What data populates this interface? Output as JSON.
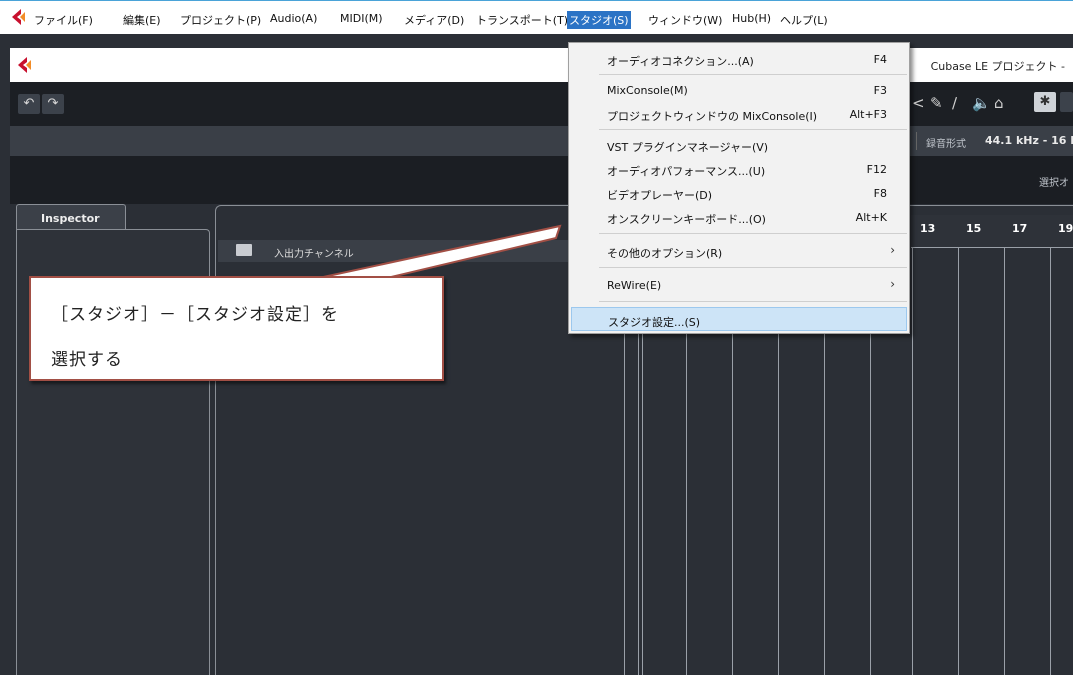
{
  "colors": {
    "accent": "#2b73c5",
    "callout_border": "#a24f45",
    "menu_highlight": "#cde4f7",
    "dark_bg": "#2b2f36"
  },
  "menubar": {
    "items": [
      "ファイル(F)",
      "編集(E)",
      "プロジェクト(P)",
      "Audio(A)",
      "MIDI(M)",
      "メディア(D)",
      "トランスポート(T)",
      "スタジオ(S)",
      "ウィンドウ(W)",
      "Hub(H)",
      "ヘルプ(L)"
    ],
    "active": "スタジオ(S)"
  },
  "window": {
    "title": "Cubase LE プロジェクト -"
  },
  "infobar": {
    "record_format_label": "録音形式",
    "record_format_value": "44.1 kHz - 16 B"
  },
  "band": {
    "select_label": "選択オ"
  },
  "inspector": {
    "tab_label": "Inspector"
  },
  "track": {
    "name": "入出力チャンネル"
  },
  "ruler": {
    "numbers": [
      "13",
      "15",
      "17",
      "19"
    ]
  },
  "dropdown": {
    "items": [
      {
        "label": "オーディオコネクション...(A)",
        "shortcut": "F4"
      },
      {
        "label": "MixConsole(M)",
        "shortcut": "F3"
      },
      {
        "label": "プロジェクトウィンドウの MixConsole(I)",
        "shortcut": "Alt+F3"
      },
      {
        "label": "VST プラグインマネージャー(V)",
        "shortcut": ""
      },
      {
        "label": "オーディオパフォーマンス...(U)",
        "shortcut": "F12"
      },
      {
        "label": "ビデオプレーヤー(D)",
        "shortcut": "F8"
      },
      {
        "label": "オンスクリーンキーボード...(O)",
        "shortcut": "Alt+K"
      },
      {
        "label": "その他のオプション(R)",
        "shortcut": ""
      },
      {
        "label": "ReWire(E)",
        "shortcut": ""
      },
      {
        "label": "スタジオ設定...(S)",
        "shortcut": ""
      }
    ]
  },
  "callout": {
    "line1": "［スタジオ］－［スタジオ設定］を",
    "line2": "選択する"
  }
}
